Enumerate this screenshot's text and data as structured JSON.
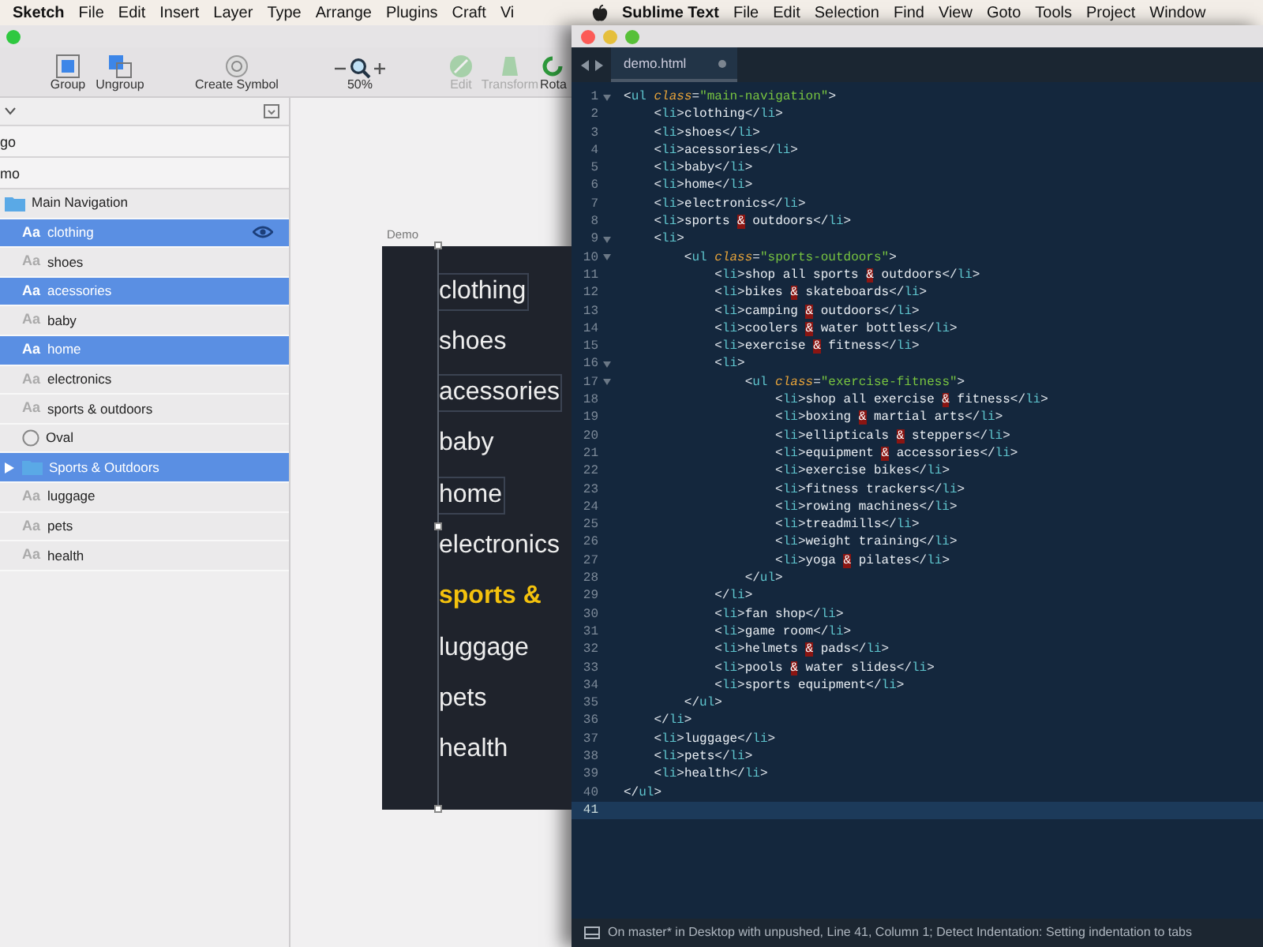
{
  "sketch": {
    "menu": [
      {
        "label": "Sketch",
        "kind": "app"
      },
      {
        "label": "File",
        "kind": "menu"
      },
      {
        "label": "Edit",
        "kind": "menu"
      },
      {
        "label": "Insert",
        "kind": "menu"
      },
      {
        "label": "Layer",
        "kind": "menu"
      },
      {
        "label": "Type",
        "kind": "menu"
      },
      {
        "label": "Arrange",
        "kind": "menu"
      },
      {
        "label": "Plugins",
        "kind": "menu"
      },
      {
        "label": "Craft",
        "kind": "menu"
      },
      {
        "label": "Vi",
        "kind": "menu"
      }
    ],
    "toolbar": [
      {
        "label": "Group",
        "kind": "group",
        "disabled": false
      },
      {
        "label": "Ungroup",
        "kind": "ungroup",
        "disabled": false
      },
      {
        "label": "Create Symbol",
        "kind": "symbol",
        "disabled": false
      },
      {
        "label": "50%",
        "kind": "zoom",
        "disabled": false
      },
      {
        "label": "Edit",
        "kind": "edit",
        "disabled": true
      },
      {
        "label": "Transform",
        "kind": "transform",
        "disabled": true
      },
      {
        "label": "Rota",
        "kind": "rotate",
        "disabled": false
      }
    ],
    "pages": [
      {
        "name": "go"
      },
      {
        "name": "mo"
      }
    ],
    "layers": [
      {
        "kind": "group",
        "name": "Main Navigation",
        "selected": false,
        "hovered": false,
        "children": [
          {
            "kind": "text",
            "glyph": "Aa",
            "name": "clothing",
            "selected": true,
            "hovered": true
          },
          {
            "kind": "text",
            "glyph": "Aa",
            "name": "shoes",
            "selected": false,
            "hovered": false
          },
          {
            "kind": "text",
            "glyph": "Aa",
            "name": "acessories",
            "selected": true,
            "hovered": false
          },
          {
            "kind": "text",
            "glyph": "Aa",
            "name": "baby",
            "selected": false,
            "hovered": false
          },
          {
            "kind": "text",
            "glyph": "Aa",
            "name": "home",
            "selected": true,
            "hovered": false
          },
          {
            "kind": "text",
            "glyph": "Aa",
            "name": "electronics",
            "selected": false,
            "hovered": false
          },
          {
            "kind": "text",
            "glyph": "Aa",
            "name": "sports & outdoors",
            "selected": false,
            "hovered": false
          },
          {
            "kind": "oval",
            "name": "Oval",
            "selected": false,
            "hovered": false
          },
          {
            "kind": "group",
            "name": "Sports & Outdoors",
            "selected": true,
            "hovered": false,
            "expanded": false
          },
          {
            "kind": "text",
            "glyph": "Aa",
            "name": "luggage",
            "selected": false,
            "hovered": false
          },
          {
            "kind": "text",
            "glyph": "Aa",
            "name": "pets",
            "selected": false,
            "hovered": false
          },
          {
            "kind": "text",
            "glyph": "Aa",
            "name": "health",
            "selected": false,
            "hovered": false
          }
        ]
      }
    ],
    "artboard": {
      "name": "Demo",
      "items": [
        {
          "text": "clothing",
          "selected": true,
          "highlighted": false
        },
        {
          "text": "shoes",
          "selected": false,
          "highlighted": false
        },
        {
          "text": "acessories",
          "selected": true,
          "highlighted": false
        },
        {
          "text": "baby",
          "selected": false,
          "highlighted": false
        },
        {
          "text": "home",
          "selected": true,
          "highlighted": false
        },
        {
          "text": "electronics",
          "selected": false,
          "highlighted": false
        },
        {
          "text": "sports &",
          "selected": false,
          "highlighted": true
        },
        {
          "text": "luggage",
          "selected": false,
          "highlighted": false
        },
        {
          "text": "pets",
          "selected": false,
          "highlighted": false
        },
        {
          "text": "health",
          "selected": false,
          "highlighted": false
        }
      ]
    }
  },
  "sublime": {
    "menu": [
      {
        "kind": "system"
      },
      {
        "label": "Sublime Text",
        "kind": "app"
      },
      {
        "label": "File",
        "kind": "menu"
      },
      {
        "label": "Edit",
        "kind": "menu"
      },
      {
        "label": "Selection",
        "kind": "menu"
      },
      {
        "label": "Find",
        "kind": "menu"
      },
      {
        "label": "View",
        "kind": "menu"
      },
      {
        "label": "Goto",
        "kind": "menu"
      },
      {
        "label": "Tools",
        "kind": "menu"
      },
      {
        "label": "Project",
        "kind": "menu"
      },
      {
        "label": "Window",
        "kind": "menu"
      }
    ],
    "tabs": [
      {
        "label": "demo.html",
        "selected": true,
        "modified": true
      }
    ],
    "lines": [
      {
        "number": "1",
        "text": "<ul class=\"main-navigation\">",
        "fold": true,
        "current": false
      },
      {
        "number": "2",
        "text": "    <li>clothing</li>",
        "fold": false,
        "current": false
      },
      {
        "number": "3",
        "text": "    <li>shoes</li>",
        "fold": false,
        "current": false
      },
      {
        "number": "4",
        "text": "    <li>acessories</li>",
        "fold": false,
        "current": false
      },
      {
        "number": "5",
        "text": "    <li>baby</li>",
        "fold": false,
        "current": false
      },
      {
        "number": "6",
        "text": "    <li>home</li>",
        "fold": false,
        "current": false
      },
      {
        "number": "7",
        "text": "    <li>electronics</li>",
        "fold": false,
        "current": false
      },
      {
        "number": "8",
        "text": "    <li>sports & outdoors</li>",
        "fold": false,
        "current": false
      },
      {
        "number": "9",
        "text": "    <li>",
        "fold": true,
        "current": false
      },
      {
        "number": "10",
        "text": "        <ul class=\"sports-outdoors\">",
        "fold": true,
        "current": false
      },
      {
        "number": "11",
        "text": "            <li>shop all sports & outdoors</li>",
        "fold": false,
        "current": false
      },
      {
        "number": "12",
        "text": "            <li>bikes & skateboards</li>",
        "fold": false,
        "current": false
      },
      {
        "number": "13",
        "text": "            <li>camping & outdoors</li>",
        "fold": false,
        "current": false
      },
      {
        "number": "14",
        "text": "            <li>coolers & water bottles</li>",
        "fold": false,
        "current": false
      },
      {
        "number": "15",
        "text": "            <li>exercise & fitness</li>",
        "fold": false,
        "current": false
      },
      {
        "number": "16",
        "text": "            <li>",
        "fold": true,
        "current": false
      },
      {
        "number": "17",
        "text": "                <ul class=\"exercise-fitness\">",
        "fold": true,
        "current": false
      },
      {
        "number": "18",
        "text": "                    <li>shop all exercise & fitness</li>",
        "fold": false,
        "current": false
      },
      {
        "number": "19",
        "text": "                    <li>boxing & martial arts</li>",
        "fold": false,
        "current": false
      },
      {
        "number": "20",
        "text": "                    <li>ellipticals & steppers</li>",
        "fold": false,
        "current": false
      },
      {
        "number": "21",
        "text": "                    <li>equipment & accessories</li>",
        "fold": false,
        "current": false
      },
      {
        "number": "22",
        "text": "                    <li>exercise bikes</li>",
        "fold": false,
        "current": false
      },
      {
        "number": "23",
        "text": "                    <li>fitness trackers</li>",
        "fold": false,
        "current": false
      },
      {
        "number": "24",
        "text": "                    <li>rowing machines</li>",
        "fold": false,
        "current": false
      },
      {
        "number": "25",
        "text": "                    <li>treadmills</li>",
        "fold": false,
        "current": false
      },
      {
        "number": "26",
        "text": "                    <li>weight training</li>",
        "fold": false,
        "current": false
      },
      {
        "number": "27",
        "text": "                    <li>yoga & pilates</li>",
        "fold": false,
        "current": false
      },
      {
        "number": "28",
        "text": "                </ul>",
        "fold": false,
        "current": false
      },
      {
        "number": "29",
        "text": "            </li>",
        "fold": false,
        "current": false
      },
      {
        "number": "30",
        "text": "            <li>fan shop</li>",
        "fold": false,
        "current": false
      },
      {
        "number": "31",
        "text": "            <li>game room</li>",
        "fold": false,
        "current": false
      },
      {
        "number": "32",
        "text": "            <li>helmets & pads</li>",
        "fold": false,
        "current": false
      },
      {
        "number": "33",
        "text": "            <li>pools & water slides</li>",
        "fold": false,
        "current": false
      },
      {
        "number": "34",
        "text": "            <li>sports equipment</li>",
        "fold": false,
        "current": false
      },
      {
        "number": "35",
        "text": "        </ul>",
        "fold": false,
        "current": false
      },
      {
        "number": "36",
        "text": "    </li>",
        "fold": false,
        "current": false
      },
      {
        "number": "37",
        "text": "    <li>luggage</li>",
        "fold": false,
        "current": false
      },
      {
        "number": "38",
        "text": "    <li>pets</li>",
        "fold": false,
        "current": false
      },
      {
        "number": "39",
        "text": "    <li>health</li>",
        "fold": false,
        "current": false
      },
      {
        "number": "40",
        "text": "</ul>",
        "fold": false,
        "current": false
      },
      {
        "number": "41",
        "fold": false,
        "current": true
      }
    ],
    "status_bar": "On master* in Desktop with unpushed, Line 41, Column 1; Detect Indentation: Setting indentation to tabs"
  }
}
